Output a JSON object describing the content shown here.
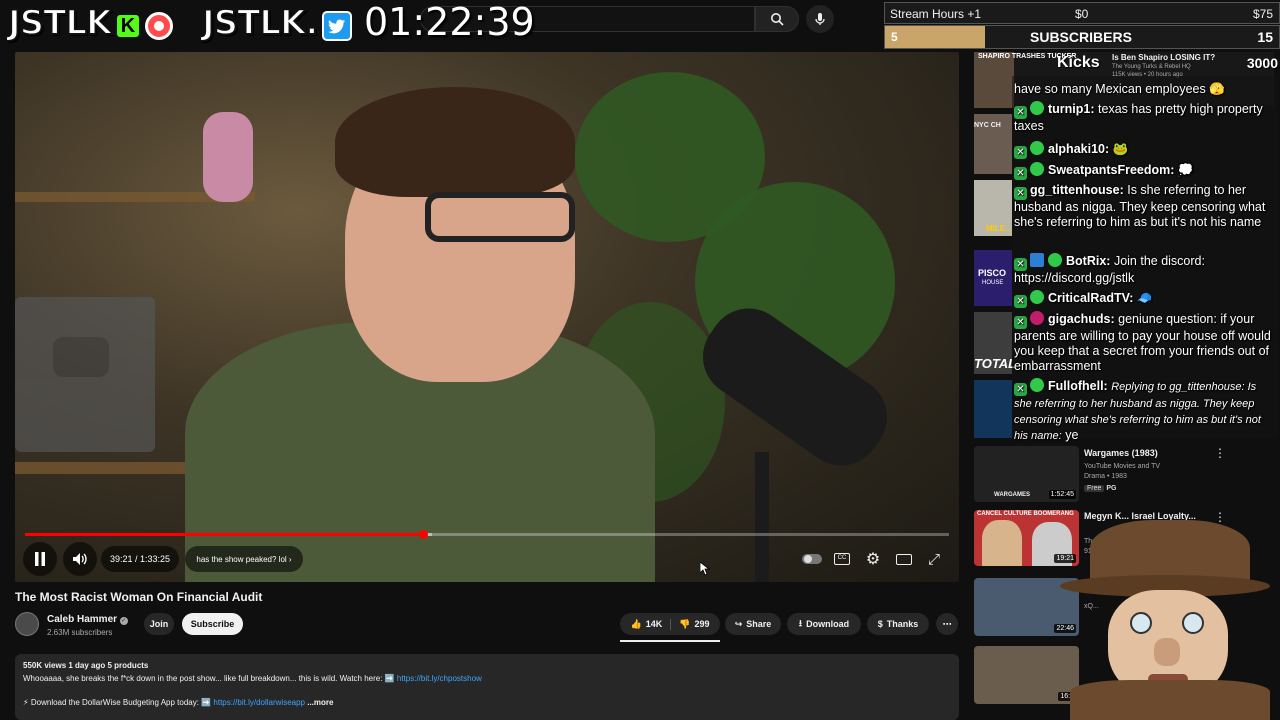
{
  "overlay": {
    "logo_left": "JSTLK",
    "kick_letter": "K",
    "logo_right": "JSTLK.",
    "timer": "01:22:39",
    "stream_hours_label": "Stream Hours +1",
    "stream_hours_min": "$0",
    "stream_hours_max": "$75",
    "subscribers_label": "SUBSCRIBERS",
    "subscribers_current": "5",
    "subscribers_goal": "15",
    "kicks_label": "Kicks",
    "kicks_current": "0",
    "kicks_goal": "3000"
  },
  "player": {
    "time_display": "39:21 / 1:33:25",
    "chapter": "has the show peaked? lol",
    "progress_fraction": 0.431
  },
  "video": {
    "title": "The Most Racist Woman On Financial Audit",
    "channel": "Caleb Hammer",
    "subscribers": "2.63M subscribers",
    "join": "Join",
    "subscribe": "Subscribe",
    "likes": "14K",
    "dislikes": "299",
    "share": "Share",
    "download": "Download",
    "thanks": "Thanks"
  },
  "description": {
    "meta": "550K views  1 day ago  5 products",
    "line1": "Whooaaaa, she breaks the f*ck down in the post show... like full breakdown... this is wild. Watch here: ",
    "link1": "https://bit.ly/chpostshow",
    "line2": "Download the DollarWise Budgeting App today: ",
    "link2": "https://bit.ly/dollarwiseapp",
    "more": "...more"
  },
  "recommendations": [
    {
      "title": "Wargames (1983)",
      "meta1": "YouTube Movies and TV",
      "meta2": "Drama • 1983",
      "badge1": "Free",
      "badge2": "PG",
      "duration": "1:52:45",
      "thumb_text": "WARGAMES"
    },
    {
      "title": "Megyn K... Israel Loyalty...",
      "meta1": "The Yo...",
      "meta2": "91K...",
      "duration": "19:21",
      "thumb_text": "CANCEL CULTURE BOOMERANG"
    },
    {
      "title": "",
      "meta1": "xQ...",
      "meta2": "",
      "duration": "22:46"
    },
    {
      "title": "",
      "meta1": "",
      "meta2": "",
      "duration": "16:2"
    }
  ],
  "hidden_recs": {
    "top_title": "SHAPIRO TRASHES TUCKER",
    "top_side": "Is Ben Shapiro LOSING IT?",
    "top_meta": "The Young Turks & Rebel HQ",
    "top_views": "115K views • 20 hours ago",
    "nyc": "NYC CH",
    "mile": "MILE...",
    "pisco": "PISCO",
    "house": "HOUSE",
    "total": "TOTAL"
  },
  "chat": [
    {
      "user": "",
      "text": "have so many Mexican employees 🫣"
    },
    {
      "user": "turnip1:",
      "text": "texas has pretty high property taxes"
    },
    {
      "user": "alphaki10:",
      "text": "🐸"
    },
    {
      "user": "SweatpantsFreedom:",
      "text": "💭"
    },
    {
      "user": "gg_tittenhouse:",
      "text": "Is she referring to her husband as nigga. They keep censoring what she's referring to him as but it's not his name"
    },
    {
      "user": "BotRix:",
      "text": "Join the discord: https://discord.gg/jstlk"
    },
    {
      "user": "CriticalRadTV:",
      "text": "🧢"
    },
    {
      "user": "gigachuds:",
      "text": "geniune question: if your parents are willing to pay your house off would you keep that a secret from your friends out of embarrassment"
    },
    {
      "user": "Fullofhell:",
      "reply": "Replying to gg_tittenhouse: Is she referring to her husband as nigga. They keep censoring what she's referring to him as but it's not his name:",
      "text": "ye"
    }
  ]
}
